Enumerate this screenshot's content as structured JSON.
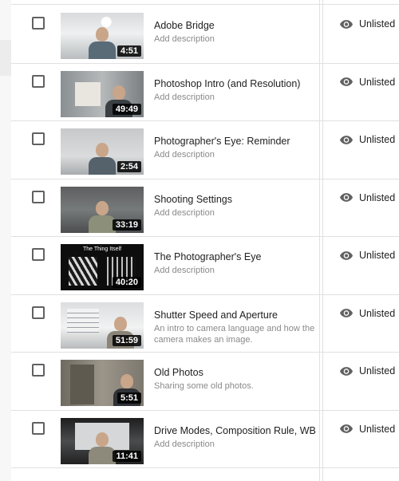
{
  "videos": [
    {
      "title": "Adobe Bridge",
      "description": "Add description",
      "duration": "4:51",
      "visibility": "Unlisted"
    },
    {
      "title": "Photoshop Intro (and Resolution)",
      "description": "Add description",
      "duration": "49:49",
      "visibility": "Unlisted"
    },
    {
      "title": "Photographer's Eye: Reminder",
      "description": "Add description",
      "duration": "2:54",
      "visibility": "Unlisted"
    },
    {
      "title": "Shooting Settings",
      "description": "Add description",
      "duration": "33:19",
      "visibility": "Unlisted"
    },
    {
      "title": "The Photographer's Eye",
      "description": "Add description",
      "duration": "40:20",
      "visibility": "Unlisted"
    },
    {
      "title": "Shutter Speed and Aperture",
      "description": "An intro to camera language and how the camera makes an image.",
      "duration": "51:59",
      "visibility": "Unlisted"
    },
    {
      "title": "Old Photos",
      "description": "Sharing some old photos.",
      "duration": "5:51",
      "visibility": "Unlisted"
    },
    {
      "title": "Drive Modes, Composition Rule, WB I...",
      "description": "Add description",
      "duration": "11:41",
      "visibility": "Unlisted"
    }
  ],
  "thumbnail_text": {
    "row_5": "The Thing Itself"
  },
  "icons": {
    "visibility": "eye-icon"
  },
  "colors": {
    "description_placeholder": "#8a8a8a",
    "divider": "#e0e0e0"
  }
}
